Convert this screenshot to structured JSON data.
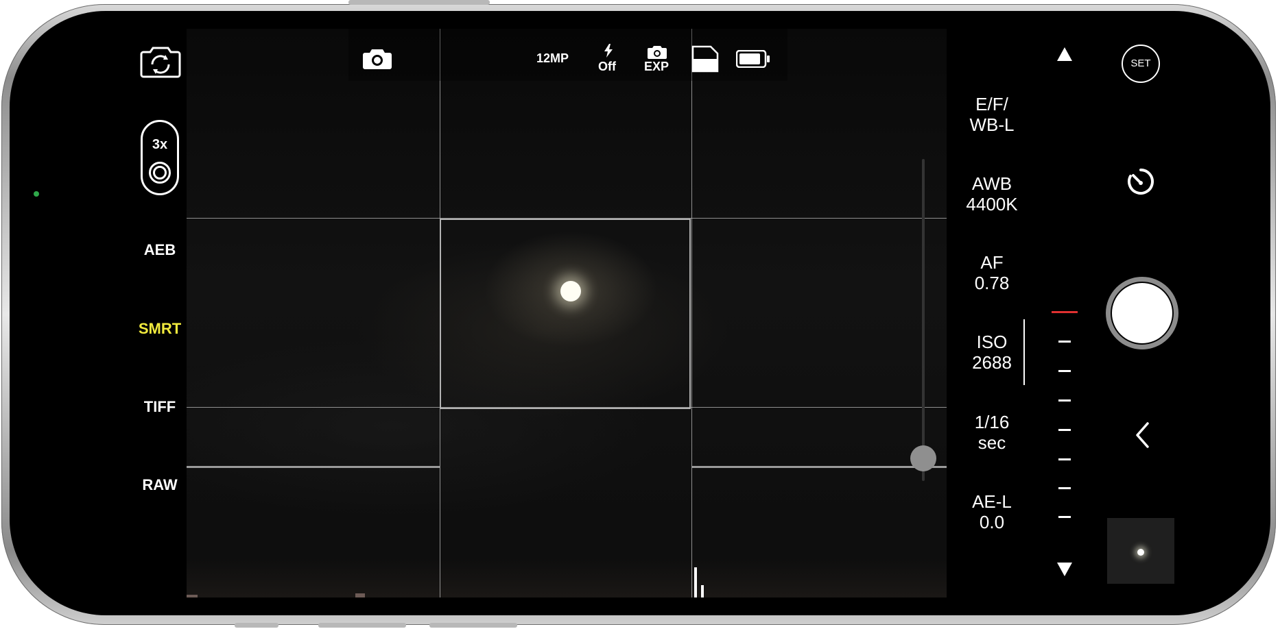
{
  "top_bar": {
    "resolution": "12MP",
    "flash_label": "Off",
    "exposure_label": "EXP"
  },
  "left_menu": {
    "zoom_label": "3x",
    "items": [
      {
        "label": "AEB",
        "active": false
      },
      {
        "label": "SMRT",
        "active": true
      },
      {
        "label": "TIFF",
        "active": false
      },
      {
        "label": "RAW",
        "active": false
      }
    ]
  },
  "right_settings": {
    "ef_wb": {
      "line1": "E/F/",
      "line2": "WB-L"
    },
    "awb": {
      "line1": "AWB",
      "line2": "4400K"
    },
    "af": {
      "line1": "AF",
      "line2": "0.78"
    },
    "iso": {
      "line1": "ISO",
      "line2": "2688"
    },
    "shutter": {
      "line1": "1/16",
      "line2": "sec"
    },
    "ae": {
      "line1": "AE-L",
      "line2": "0.0"
    }
  },
  "controls": {
    "set_label": "SET"
  },
  "colors": {
    "active_yellow": "#f1ea3d",
    "scale_marker_red": "#e03030",
    "camera_indicator_green": "#2fa84a"
  }
}
